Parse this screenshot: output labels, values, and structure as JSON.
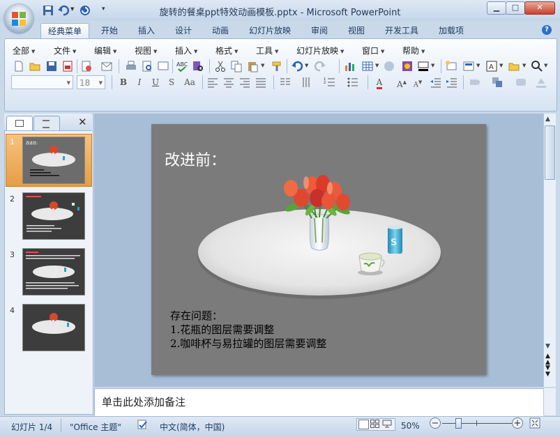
{
  "window": {
    "title": "旋转的餐桌ppt特效动画模板.pptx - Microsoft PowerPoint",
    "minimize_label": "▁",
    "maximize_label": "□",
    "close_label": "✕"
  },
  "ribbon_tabs": [
    "经典菜单",
    "开始",
    "插入",
    "设计",
    "动画",
    "幻灯片放映",
    "审阅",
    "视图",
    "开发工具",
    "加载项"
  ],
  "classic_menu": [
    "全部",
    "文件",
    "编辑",
    "视图",
    "插入",
    "格式",
    "工具",
    "幻灯片放映",
    "窗口",
    "帮助"
  ],
  "toolbar": {
    "font_size_value": "18"
  },
  "slides_pane": {
    "numbers": [
      "1",
      "2",
      "3",
      "4"
    ],
    "selected_index": 1
  },
  "slide": {
    "title": "改进前：",
    "body_heading": "存在问题：",
    "issues": [
      "1.花瓶的图层需要调整",
      "2.咖啡杯与易拉罐的图层需要调整"
    ]
  },
  "notes": {
    "placeholder": "单击此处添加备注"
  },
  "status": {
    "slide_indicator": "幻灯片 1/4",
    "theme": "\"Office 主题\"",
    "language": "中文(简体，中国)",
    "zoom": "50%"
  }
}
